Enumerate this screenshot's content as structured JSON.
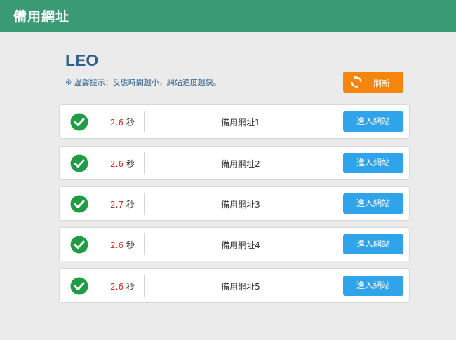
{
  "header": {
    "title": "備用網址"
  },
  "brand": {
    "name": "LEO"
  },
  "hint": {
    "text": "※ 溫馨提示：反應時間越小，網站速度越快。"
  },
  "refresh": {
    "label": "刷新",
    "icon": "refresh-icon"
  },
  "colors": {
    "header_bg": "#3a9a76",
    "accent_orange": "#f5850c",
    "accent_blue": "#2fa4ea",
    "speed_red": "#d12a1a",
    "check_green": "#1f9d45"
  },
  "rows": [
    {
      "time": "2.6",
      "unit": "秒",
      "site": "備用網址1",
      "button": "進入網站"
    },
    {
      "time": "2.6",
      "unit": "秒",
      "site": "備用網址2",
      "button": "進入網站"
    },
    {
      "time": "2.7",
      "unit": "秒",
      "site": "備用網址3",
      "button": "進入網站"
    },
    {
      "time": "2.6",
      "unit": "秒",
      "site": "備用網址4",
      "button": "進入網站"
    },
    {
      "time": "2.6",
      "unit": "秒",
      "site": "備用網址5",
      "button": "進入網站"
    }
  ]
}
